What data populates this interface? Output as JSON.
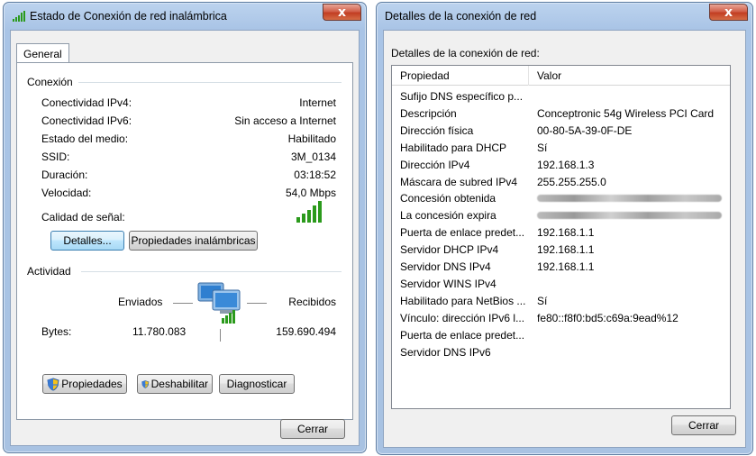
{
  "status_window": {
    "title": "Estado de Conexión de red inalámbrica",
    "close_glyph": "x",
    "tab_general": "General",
    "connection_section": "Conexión",
    "rows": [
      {
        "label": "Conectividad IPv4:",
        "value": "Internet"
      },
      {
        "label": "Conectividad IPv6:",
        "value": "Sin acceso a Internet"
      },
      {
        "label": "Estado del medio:",
        "value": "Habilitado"
      },
      {
        "label": "SSID:",
        "value": "3M_0134"
      },
      {
        "label": "Duración:",
        "value": "03:18:52"
      },
      {
        "label": "Velocidad:",
        "value": "54,0 Mbps"
      }
    ],
    "signal_label": "Calidad de señal:",
    "signal_bars": 5,
    "details_button": "Detalles...",
    "wireless_props_button": "Propiedades inalámbricas",
    "activity_section": "Actividad",
    "sent_label": "Enviados",
    "received_label": "Recibidos",
    "bytes_label": "Bytes:",
    "bytes_sent": "11.780.083",
    "bytes_received": "159.690.494",
    "properties_button": "Propiedades",
    "disable_button": "Deshabilitar",
    "diagnose_button": "Diagnosticar",
    "close_button": "Cerrar"
  },
  "details_window": {
    "title": "Detalles de la conexión de red",
    "close_glyph": "x",
    "details_label": "Detalles de la conexión de red:",
    "col_property": "Propiedad",
    "col_value": "Valor",
    "rows": [
      {
        "p": "Sufijo DNS específico p...",
        "v": ""
      },
      {
        "p": "Descripción",
        "v": "Conceptronic 54g Wireless PCI Card"
      },
      {
        "p": "Dirección física",
        "v": "00-80-5A-39-0F-DE"
      },
      {
        "p": "Habilitado para DHCP",
        "v": "Sí"
      },
      {
        "p": "Dirección IPv4",
        "v": "192.168.1.3"
      },
      {
        "p": "Máscara de subred IPv4",
        "v": "255.255.255.0"
      },
      {
        "p": "Concesión obtenida",
        "v": ""
      },
      {
        "p": "La concesión expira",
        "v": ""
      },
      {
        "p": "Puerta de enlace predet...",
        "v": "192.168.1.1"
      },
      {
        "p": "Servidor DHCP IPv4",
        "v": "192.168.1.1"
      },
      {
        "p": "Servidor DNS IPv4",
        "v": "192.168.1.1"
      },
      {
        "p": "Servidor WINS IPv4",
        "v": ""
      },
      {
        "p": "Habilitado para NetBios ...",
        "v": "Sí"
      },
      {
        "p": "Vínculo: dirección IPv6 l...",
        "v": "fe80::f8f0:bd5:c69a:9ead%12"
      },
      {
        "p": "Puerta de enlace predet...",
        "v": ""
      },
      {
        "p": "Servidor DNS IPv6",
        "v": ""
      }
    ],
    "close_button": "Cerrar"
  },
  "colors": {
    "title_bar": "#a9c4e6",
    "close_red": "#c23e23",
    "signal_green": "#2b9a1c"
  },
  "icons": {
    "title_icon": "wireless-signal-icon",
    "network_icon": "network-computers-icon",
    "shield": "uac-shield-icon"
  }
}
